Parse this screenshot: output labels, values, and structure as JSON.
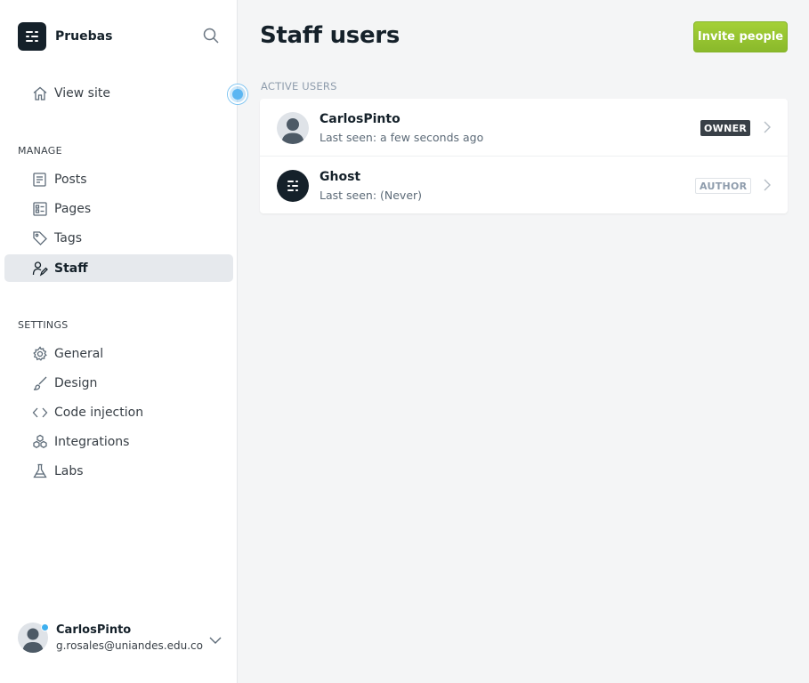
{
  "sidebar": {
    "brand": {
      "name": "Pruebas"
    },
    "view_site": "View site",
    "manage_title": "MANAGE",
    "manage_items": [
      {
        "label": "Posts",
        "icon": "posts-icon"
      },
      {
        "label": "Pages",
        "icon": "pages-icon"
      },
      {
        "label": "Tags",
        "icon": "tag-icon"
      },
      {
        "label": "Staff",
        "icon": "staff-icon",
        "active": true
      }
    ],
    "settings_title": "SETTINGS",
    "settings_items": [
      {
        "label": "General",
        "icon": "gear-icon"
      },
      {
        "label": "Design",
        "icon": "brush-icon"
      },
      {
        "label": "Code injection",
        "icon": "code-icon"
      },
      {
        "label": "Integrations",
        "icon": "integrations-icon"
      },
      {
        "label": "Labs",
        "icon": "flask-icon"
      }
    ],
    "account": {
      "name": "CarlosPinto",
      "email": "g.rosales@uniandes.edu.co"
    }
  },
  "main": {
    "title": "Staff users",
    "invite_label": "Invite people",
    "active_users_label": "ACTIVE USERS",
    "users": [
      {
        "name": "CarlosPinto",
        "last_seen": "Last seen: a few seconds ago",
        "role": "OWNER"
      },
      {
        "name": "Ghost",
        "last_seen": "Last seen: (Never)",
        "role": "AUTHOR"
      }
    ]
  },
  "colors": {
    "accent_green": "#97c634",
    "active_bg": "#e6e9ed",
    "dark": "#15212a",
    "status_blue": "#5bb6f2"
  }
}
